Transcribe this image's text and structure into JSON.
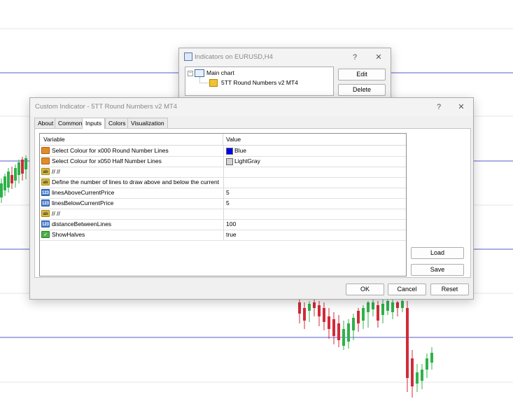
{
  "colors": {
    "grid_line": "#e4e4e4",
    "level_line": "#5a5ad2",
    "bull": "#2fb24a",
    "bear": "#d12b3a"
  },
  "indicators_window": {
    "title": "Indicators on EURUSD,H4",
    "help_icon": "?",
    "close_icon": "✕",
    "tree": {
      "root_label": "Main chart",
      "child_label": "5TT Round Numbers v2 MT4"
    },
    "buttons": {
      "edit": "Edit",
      "delete": "Delete"
    }
  },
  "custom_indicator_window": {
    "title": "Custom Indicator - 5TT Round Numbers v2 MT4",
    "help_icon": "?",
    "close_icon": "✕",
    "tabs": [
      "About",
      "Common",
      "Inputs",
      "Colors",
      "Visualization"
    ],
    "active_tab": "Inputs",
    "table": {
      "headers": [
        "Variable",
        "Value"
      ],
      "rows": [
        {
          "icon": "color",
          "variable": "Select Colour for x000 Round Number Lines",
          "value": "Blue",
          "swatch": "#0000ee"
        },
        {
          "icon": "color",
          "variable": "Select Colour for x050 Half Number Lines",
          "value": "LightGray",
          "swatch": "#d3d3d3"
        },
        {
          "icon": "string",
          "variable": "//    //",
          "value": ""
        },
        {
          "icon": "string",
          "variable": "Define the number of lines to draw above and below the current",
          "value": ""
        },
        {
          "icon": "int",
          "variable": "linesAboveCurrentPrice",
          "value": "5"
        },
        {
          "icon": "int",
          "variable": "linesBelowCurrentPrice",
          "value": "5"
        },
        {
          "icon": "string",
          "variable": "//    //",
          "value": ""
        },
        {
          "icon": "int",
          "variable": "distanceBetweenLines",
          "value": "100"
        },
        {
          "icon": "bool",
          "variable": "ShowHalves",
          "value": "true"
        }
      ]
    },
    "buttons": {
      "load": "Load",
      "save": "Save",
      "ok": "OK",
      "cancel": "Cancel",
      "reset": "Reset"
    }
  }
}
